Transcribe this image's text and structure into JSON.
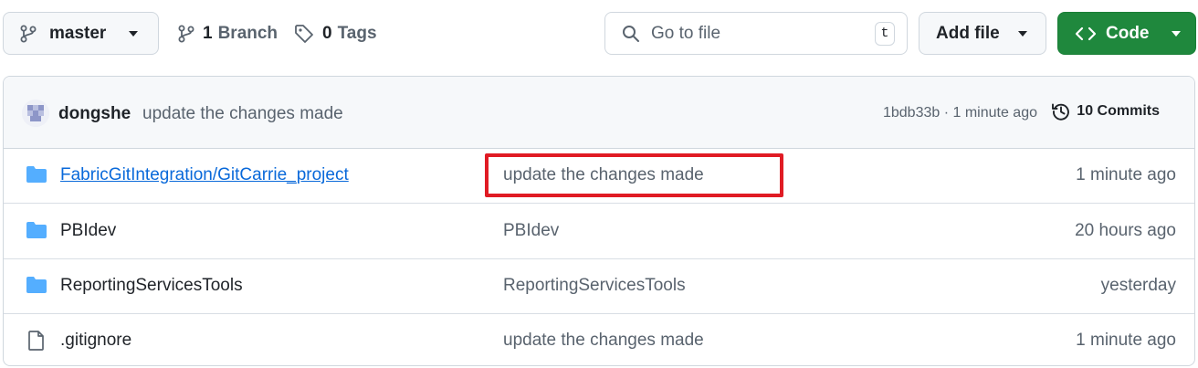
{
  "toolbar": {
    "branch_button": "master",
    "branch_count": "1",
    "branch_label": "Branch",
    "tag_count": "0",
    "tag_label": "Tags",
    "search_placeholder": "Go to file",
    "search_shortcut": "t",
    "add_file_label": "Add file",
    "code_label": "Code"
  },
  "latest_commit": {
    "author": "dongshe",
    "message": "update the changes made",
    "hash_time": "1bdb33b · 1 minute ago",
    "commits_label": "10 Commits"
  },
  "files": [
    {
      "type": "folder-icon",
      "name": "FabricGitIntegration/GitCarrie_project",
      "message": "update the changes made",
      "age": "1 minute ago"
    },
    {
      "type": "folder-icon",
      "name": "PBIdev",
      "message": "PBIdev",
      "age": "20 hours ago"
    },
    {
      "type": "folder-icon",
      "name": "ReportingServicesTools",
      "message": "ReportingServicesTools",
      "age": "yesterday"
    },
    {
      "type": "file-icon",
      "name": ".gitignore",
      "message": "update the changes made",
      "age": "1 minute ago"
    }
  ],
  "colors": {
    "accent_green": "#1f883d",
    "link_blue": "#0969da",
    "folder_blue": "#54aeff",
    "highlight_red": "#e01b24"
  }
}
